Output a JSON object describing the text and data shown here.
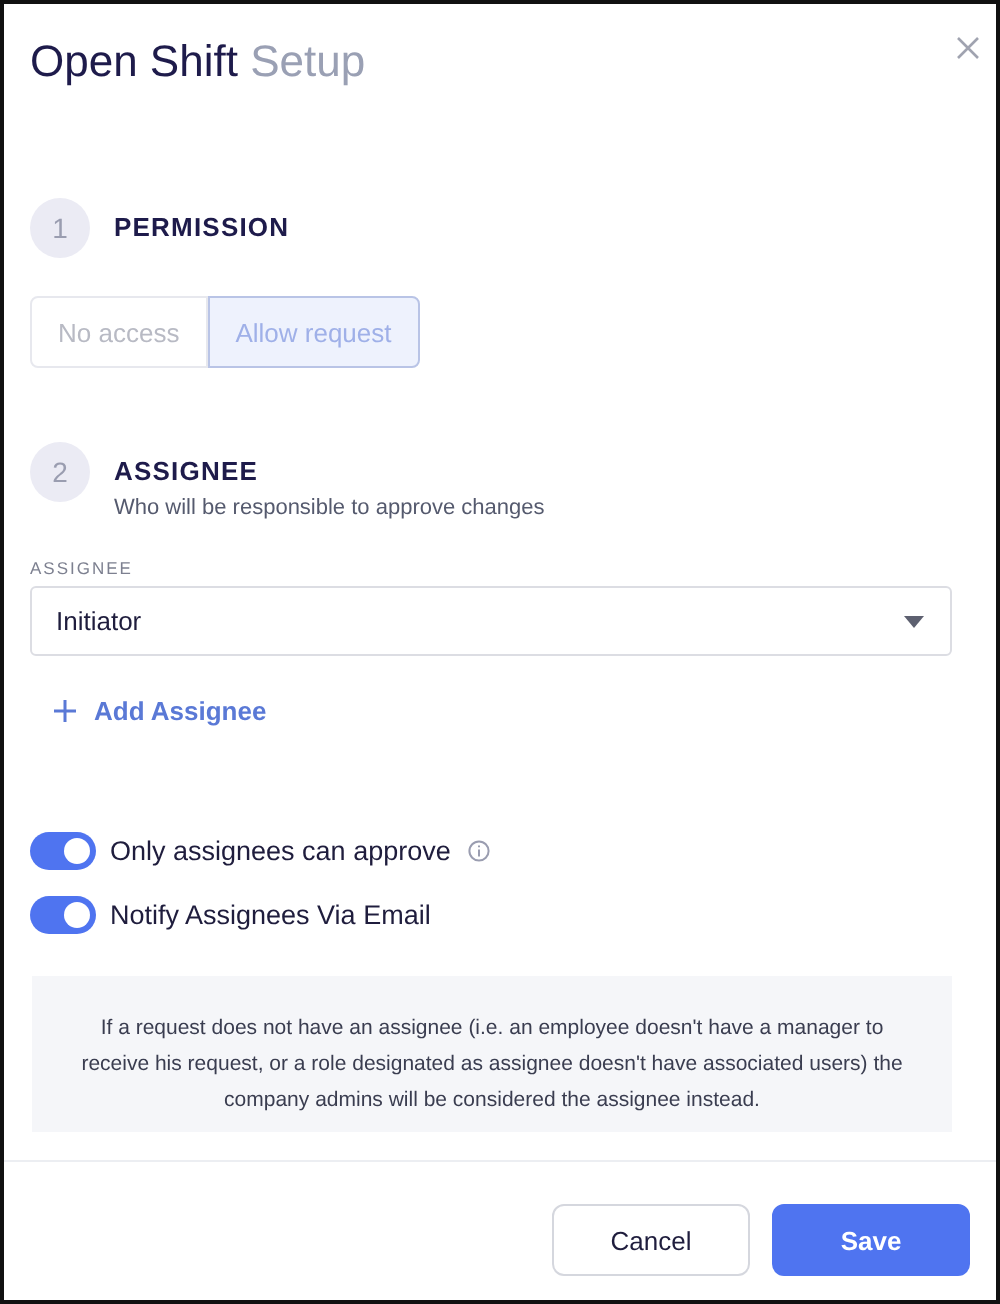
{
  "title": {
    "main": "Open Shift",
    "secondary": "Setup"
  },
  "steps": [
    {
      "number": "1",
      "title": "PERMISSION"
    },
    {
      "number": "2",
      "title": "ASSIGNEE",
      "subtitle": "Who will be responsible to approve changes"
    }
  ],
  "permission_options": [
    {
      "label": "No access",
      "selected": false
    },
    {
      "label": "Allow request",
      "selected": true
    }
  ],
  "assignee_field": {
    "label": "ASSIGNEE",
    "value": "Initiator"
  },
  "add_assignee": "Add Assignee",
  "toggles": [
    {
      "label": "Only assignees can approve",
      "on": true,
      "info": true
    },
    {
      "label": "Notify Assignees Via Email",
      "on": true,
      "info": false
    }
  ],
  "note": "If a request does not have an assignee (i.e. an employee doesn't have a manager to receive his request, or a role designated as assignee doesn't have associated users) the company admins will be considered the assignee instead.",
  "buttons": [
    {
      "label": "Cancel",
      "kind": "secondary"
    },
    {
      "label": "Save",
      "kind": "primary"
    }
  ]
}
